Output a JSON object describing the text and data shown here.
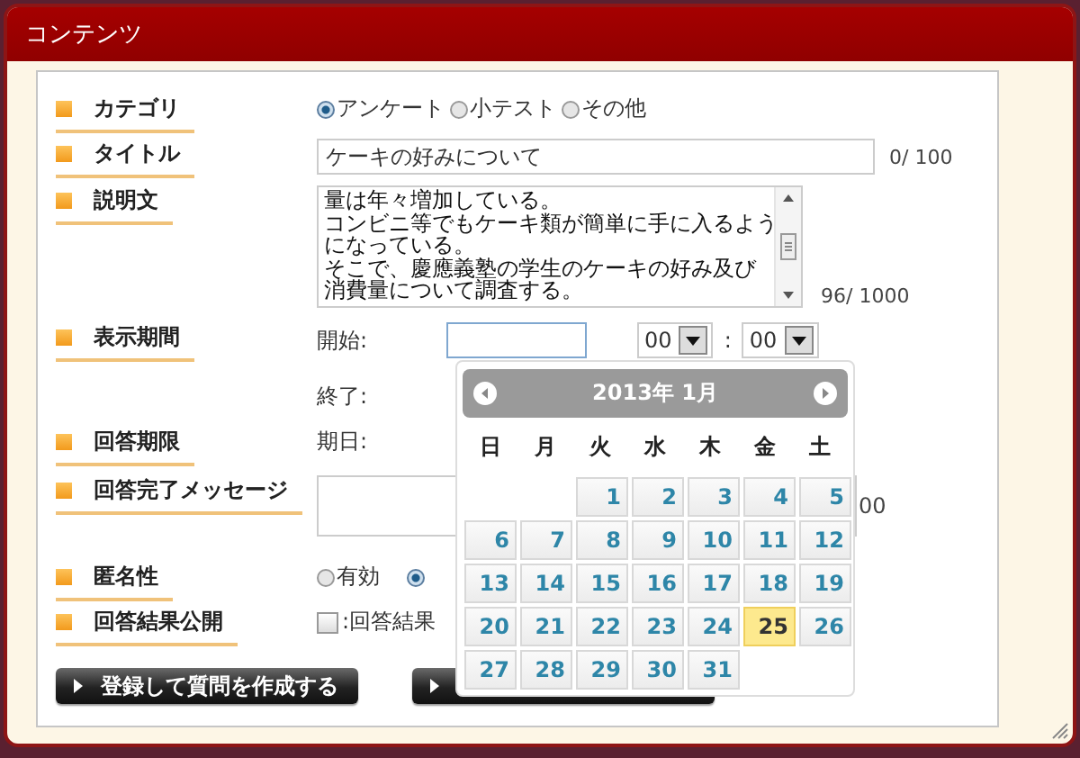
{
  "window": {
    "title": "コンテンツ"
  },
  "fields": [
    {
      "kind": "radio",
      "label": "カテゴリ",
      "options": [
        {
          "label": "アンケート",
          "selected": true
        },
        {
          "label": "小テスト",
          "selected": false
        },
        {
          "label": "その他",
          "selected": false
        }
      ]
    },
    {
      "kind": "text",
      "label": "タイトル",
      "value": "ケーキの好みについて",
      "counter": "0/ 100"
    },
    {
      "kind": "textarea",
      "label": "説明文",
      "lines": [
        "量は年々増加している。",
        "コンビニ等でもケーキ類が簡単に手に入るよう",
        "になっている。",
        "そこで、慶應義塾の学生のケーキの好み及び",
        "消費量について調査する。"
      ],
      "counter": "96/ 1000"
    },
    {
      "kind": "period",
      "label": "表示期間",
      "start_label": "開始:",
      "hour": "00",
      "separator": ":",
      "minute": "00",
      "end_label": "終了:"
    },
    {
      "kind": "deadline",
      "label": "回答期限",
      "prefix": "期日:"
    },
    {
      "kind": "message",
      "label": "回答完了メッセージ",
      "counter": "00"
    },
    {
      "kind": "radio",
      "label": "匿名性",
      "options": [
        {
          "label": "有効",
          "selected": false
        },
        {
          "selected": true
        }
      ]
    },
    {
      "kind": "checkbox",
      "label": "回答結果公開",
      "checked": false,
      "text": ":回答結果"
    }
  ],
  "buttons": [
    {
      "kind": "labeled",
      "label": "登録して質問を作成する"
    },
    {
      "kind": "icon_only"
    }
  ],
  "calendar": {
    "title": "2013年 1月",
    "weekdays": [
      "日",
      "月",
      "火",
      "水",
      "木",
      "金",
      "土"
    ],
    "weeks": [
      [
        {
          "kind": "blank"
        },
        {
          "kind": "blank"
        },
        {
          "day": "1",
          "selected": false
        },
        {
          "day": "2",
          "selected": false
        },
        {
          "day": "3",
          "selected": false
        },
        {
          "day": "4",
          "selected": false
        },
        {
          "day": "5",
          "selected": false
        }
      ],
      [
        {
          "day": "6",
          "selected": false
        },
        {
          "day": "7",
          "selected": false
        },
        {
          "day": "8",
          "selected": false
        },
        {
          "day": "9",
          "selected": false
        },
        {
          "day": "10",
          "selected": false
        },
        {
          "day": "11",
          "selected": false
        },
        {
          "day": "12",
          "selected": false
        }
      ],
      [
        {
          "day": "13",
          "selected": false
        },
        {
          "day": "14",
          "selected": false
        },
        {
          "day": "15",
          "selected": false
        },
        {
          "day": "16",
          "selected": false
        },
        {
          "day": "17",
          "selected": false
        },
        {
          "day": "18",
          "selected": false
        },
        {
          "day": "19",
          "selected": false
        }
      ],
      [
        {
          "day": "20",
          "selected": false
        },
        {
          "day": "21",
          "selected": false
        },
        {
          "day": "22",
          "selected": false
        },
        {
          "day": "23",
          "selected": false
        },
        {
          "day": "24",
          "selected": false
        },
        {
          "day": "25",
          "selected": true
        },
        {
          "day": "26",
          "selected": false
        }
      ],
      [
        {
          "day": "27",
          "selected": false
        },
        {
          "day": "28",
          "selected": false
        },
        {
          "day": "29",
          "selected": false
        },
        {
          "day": "30",
          "selected": false
        },
        {
          "day": "31",
          "selected": false
        },
        {
          "kind": "blank"
        },
        {
          "kind": "blank"
        }
      ]
    ]
  }
}
